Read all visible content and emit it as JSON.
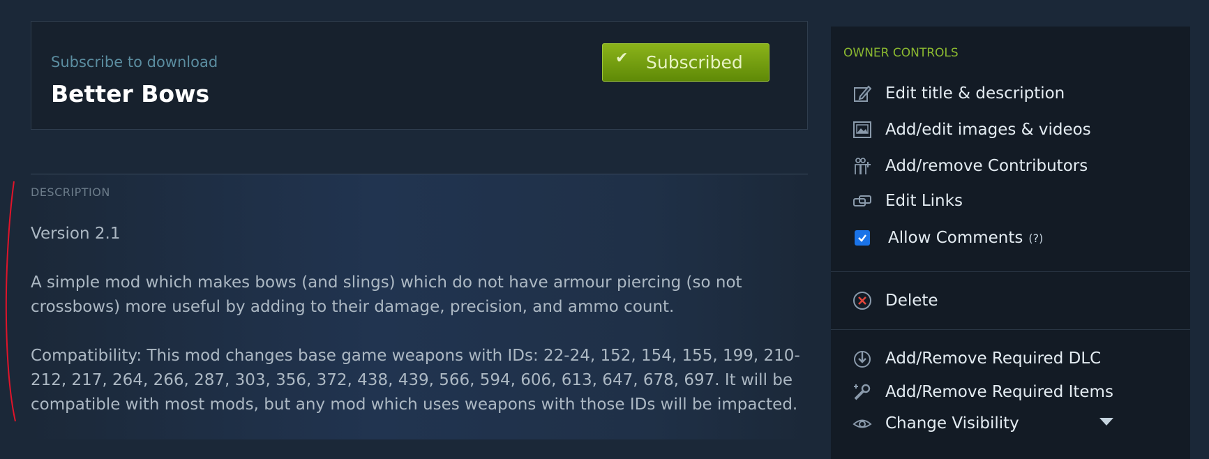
{
  "subscribe": {
    "hint": "Subscribe to download",
    "title": "Better Bows",
    "button_label": "Subscribed"
  },
  "description": {
    "heading": "DESCRIPTION",
    "paragraphs": [
      "Version 2.1",
      "A simple mod which makes bows (and slings) which do not have armour piercing (so not crossbows) more useful by adding to their damage, precision, and ammo count.",
      "Compatibility: This mod changes base game weapons with IDs: 22-24, 152, 154, 155, 199, 210-212, 217, 264, 266, 287, 303, 356, 372, 438, 439, 566, 594, 606, 613, 647, 678, 697. It will be compatible with most mods, but any mod which uses weapons with those IDs will be impacted."
    ]
  },
  "owner_controls": {
    "heading": "OWNER CONTROLS",
    "edit_title": "Edit title & description",
    "edit_images": "Add/edit images & videos",
    "contributors": "Add/remove Contributors",
    "edit_links": "Edit Links",
    "allow_comments": "Allow Comments",
    "allow_comments_help": "(?)",
    "allow_comments_checked": true,
    "delete": "Delete",
    "required_dlc": "Add/Remove Required DLC",
    "required_items": "Add/Remove Required Items",
    "visibility": "Change Visibility"
  },
  "colors": {
    "background": "#1b2838",
    "accent_green": "#8bb930",
    "button_green": "#6d9a0c",
    "checkbox_blue": "#1a73e8",
    "annotation_red": "#e0142a"
  }
}
